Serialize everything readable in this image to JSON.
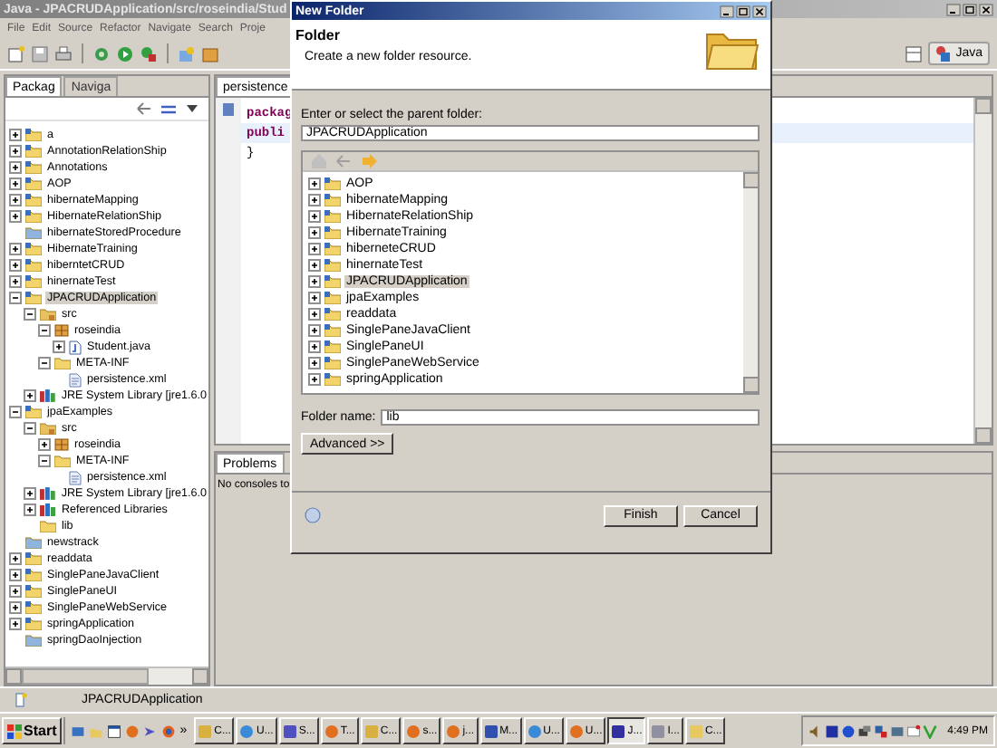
{
  "window": {
    "title": "Java - JPACRUDApplication/src/roseindia/Stud"
  },
  "menu": [
    "File",
    "Edit",
    "Source",
    "Refactor",
    "Navigate",
    "Search",
    "Proje"
  ],
  "perspective": {
    "label": "Java"
  },
  "explorer": {
    "tabs": [
      {
        "label": "Packag",
        "selected": true
      },
      {
        "label": "Naviga",
        "selected": false
      }
    ],
    "tree": [
      {
        "label": "a",
        "kind": "project",
        "expanded": false,
        "selected": false
      },
      {
        "label": "AnnotationRelationShip",
        "kind": "project",
        "expanded": false,
        "selected": false
      },
      {
        "label": "Annotations",
        "kind": "project",
        "expanded": false,
        "selected": false
      },
      {
        "label": "AOP",
        "kind": "project",
        "expanded": false,
        "selected": false
      },
      {
        "label": "hibernateMapping",
        "kind": "project",
        "expanded": false,
        "selected": false
      },
      {
        "label": "HibernateRelationShip",
        "kind": "project",
        "expanded": false,
        "selected": false
      },
      {
        "label": "hibernateStoredProcedure",
        "kind": "closed",
        "selected": false
      },
      {
        "label": "HibernateTraining",
        "kind": "project",
        "expanded": false,
        "selected": false
      },
      {
        "label": "hiberntetCRUD",
        "kind": "project",
        "expanded": false,
        "selected": false
      },
      {
        "label": "hinernateTest",
        "kind": "project",
        "expanded": false,
        "selected": false
      },
      {
        "label": "JPACRUDApplication",
        "kind": "project",
        "expanded": true,
        "selected": true,
        "children": [
          {
            "label": "src",
            "kind": "source",
            "expanded": true,
            "selected": false,
            "children": [
              {
                "label": "roseindia",
                "kind": "package",
                "expanded": true,
                "selected": false,
                "children": [
                  {
                    "label": "Student.java",
                    "kind": "java",
                    "expanded": false,
                    "selected": false
                  }
                ]
              },
              {
                "label": "META-INF",
                "kind": "folder",
                "expanded": true,
                "selected": false,
                "children": [
                  {
                    "label": "persistence.xml",
                    "kind": "xml",
                    "selected": false
                  }
                ]
              }
            ]
          },
          {
            "label": "JRE System Library [jre1.6.0",
            "kind": "library",
            "expanded": false,
            "selected": false
          }
        ]
      },
      {
        "label": "jpaExamples",
        "kind": "project",
        "expanded": true,
        "selected": false,
        "children": [
          {
            "label": "src",
            "kind": "source",
            "expanded": true,
            "selected": false,
            "children": [
              {
                "label": "roseindia",
                "kind": "package",
                "expanded": false,
                "selected": false
              },
              {
                "label": "META-INF",
                "kind": "folder",
                "expanded": true,
                "selected": false,
                "children": [
                  {
                    "label": "persistence.xml",
                    "kind": "xml",
                    "selected": false
                  }
                ]
              }
            ]
          },
          {
            "label": "JRE System Library [jre1.6.0",
            "kind": "library",
            "expanded": false,
            "selected": false
          },
          {
            "label": "Referenced Libraries",
            "kind": "library",
            "expanded": false,
            "selected": false
          },
          {
            "label": "lib",
            "kind": "empty-folder",
            "selected": false
          }
        ]
      },
      {
        "label": "newstrack",
        "kind": "closed",
        "selected": false
      },
      {
        "label": "readdata",
        "kind": "project",
        "expanded": false,
        "selected": false
      },
      {
        "label": "SinglePaneJavaClient",
        "kind": "project",
        "expanded": false,
        "selected": false
      },
      {
        "label": "SinglePaneUI",
        "kind": "project",
        "expanded": false,
        "selected": false
      },
      {
        "label": "SinglePaneWebService",
        "kind": "project",
        "expanded": false,
        "selected": false
      },
      {
        "label": "springApplication",
        "kind": "project",
        "expanded": false,
        "selected": false
      },
      {
        "label": "springDaoInjection",
        "kind": "closed",
        "selected": false
      }
    ]
  },
  "editor": {
    "tab": "persistence",
    "lines": [
      "packag",
      "publi",
      "}"
    ]
  },
  "console": {
    "tab": "Problems",
    "message": "No consoles to"
  },
  "status_bar": {
    "text": "JPACRUDApplication"
  },
  "dialog": {
    "title": "New Folder",
    "heading": "Folder",
    "description": "Create a new folder resource.",
    "parent_label": "Enter or select the parent folder:",
    "parent_value": "JPACRUDApplication",
    "folders": [
      {
        "label": "AOP",
        "selected": false
      },
      {
        "label": "hibernateMapping",
        "selected": false
      },
      {
        "label": "HibernateRelationShip",
        "selected": false
      },
      {
        "label": "HibernateTraining",
        "selected": false
      },
      {
        "label": "hiberneteCRUD",
        "selected": false
      },
      {
        "label": "hinernateTest",
        "selected": false
      },
      {
        "label": "JPACRUDApplication",
        "selected": true
      },
      {
        "label": "jpaExamples",
        "selected": false
      },
      {
        "label": "readdata",
        "selected": false
      },
      {
        "label": "SinglePaneJavaClient",
        "selected": false
      },
      {
        "label": "SinglePaneUI",
        "selected": false
      },
      {
        "label": "SinglePaneWebService",
        "selected": false
      },
      {
        "label": "springApplication",
        "selected": false
      }
    ],
    "name_label": "Folder name:",
    "name_value": "lib",
    "advanced": "Advanced >>",
    "buttons": [
      "Finish",
      "Cancel"
    ]
  },
  "taskbar": {
    "start": "Start",
    "more": "»",
    "tasks": [
      {
        "label": "C...",
        "kind": "search",
        "selected": false
      },
      {
        "label": "U...",
        "kind": "ie",
        "selected": false
      },
      {
        "label": "S...",
        "kind": "arrow",
        "selected": false
      },
      {
        "label": "T...",
        "kind": "firefox",
        "selected": false
      },
      {
        "label": "C...",
        "kind": "search",
        "selected": false
      },
      {
        "label": "s...",
        "kind": "firefox",
        "selected": false
      },
      {
        "label": "j...",
        "kind": "firefox",
        "selected": false
      },
      {
        "label": "M...",
        "kind": "network",
        "selected": false
      },
      {
        "label": "U...",
        "kind": "ie",
        "selected": false
      },
      {
        "label": "U...",
        "kind": "firefox",
        "selected": false
      },
      {
        "label": "J...",
        "kind": "eclipse",
        "selected": true
      },
      {
        "label": "I...",
        "kind": "doc",
        "selected": false
      },
      {
        "label": "C...",
        "kind": "folder",
        "selected": false
      }
    ],
    "clock": "4:49 PM"
  }
}
